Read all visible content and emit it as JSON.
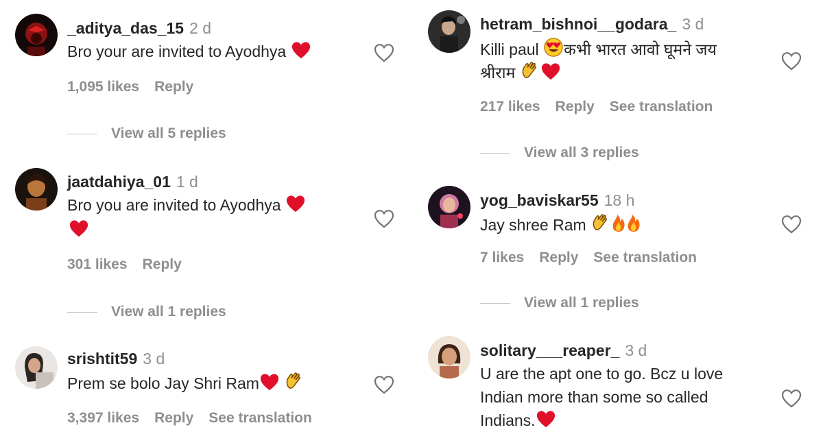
{
  "left": [
    {
      "username": "_aditya_das_15",
      "time": "2 d",
      "text": "Bro your are invited to Ayodhya",
      "likes": "1,095 likes",
      "reply": "Reply",
      "view_replies": "View all 5 replies"
    },
    {
      "username": "jaatdahiya_01",
      "time": "1 d",
      "text": "Bro you are invited to Ayodhya",
      "likes": "301 likes",
      "reply": "Reply",
      "view_replies": "View all 1 replies"
    },
    {
      "username": "srishtit59",
      "time": "3 d",
      "text": "Prem se bolo Jay Shri Ram",
      "likes": "3,397 likes",
      "reply": "Reply",
      "translation": "See translation"
    }
  ],
  "right": [
    {
      "username": "hetram_bishnoi__godara_",
      "time": "3 d",
      "text_line1": "Killi paul",
      "text_line1b": "कभी भारत आवो घूमने जय",
      "text_line2": "श्रीराम",
      "likes": "217 likes",
      "reply": "Reply",
      "translation": "See translation",
      "view_replies": "View all 3 replies"
    },
    {
      "username": "yog_baviskar55",
      "time": "18 h",
      "text": "Jay shree Ram",
      "likes": "7 likes",
      "reply": "Reply",
      "translation": "See translation",
      "view_replies": "View all 1 replies"
    },
    {
      "username": "solitary___reaper_",
      "time": "3 d",
      "text_line1": "U are the apt one to go. Bcz u love",
      "text_line2": "Indian more than some so called",
      "text_line3": "Indians.",
      "likes": "",
      "reply": ""
    }
  ],
  "icons": {
    "like": "heart-outline-icon",
    "red_heart": "red-heart-emoji",
    "clap": "clapping-hands-emoji",
    "fire": "fire-emoji",
    "heart_eyes": "heart-eyes-emoji"
  },
  "colors": {
    "text": "#262626",
    "muted": "#8e8e8e",
    "heart": "#e0102b"
  }
}
